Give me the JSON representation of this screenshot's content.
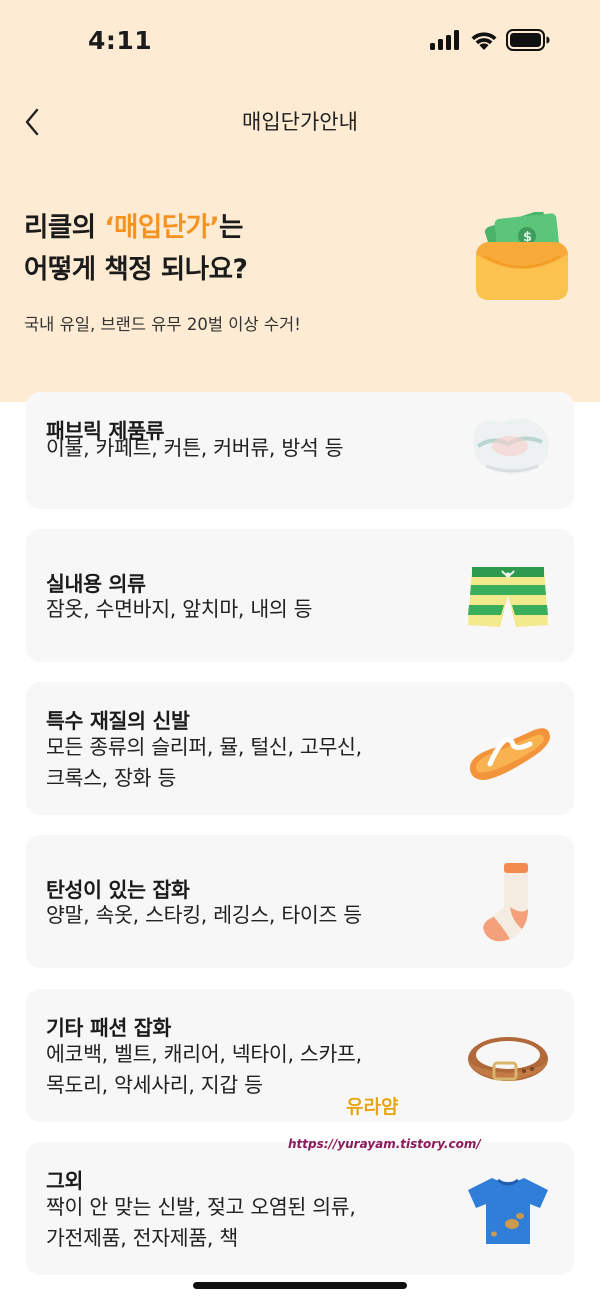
{
  "status_bar": {
    "time": "4:11"
  },
  "nav": {
    "title": "매입단가안내",
    "back_icon": "chevron-left-icon"
  },
  "hero": {
    "headline_part1": "리클의 ",
    "headline_accent": "‘매입단가’",
    "headline_part2": "는",
    "headline_line2": "어떻게 책정 되나요?",
    "subtitle": "국내 유일, 브랜드 유무 20벌 이상 수거!",
    "illustration": "money-envelope-icon",
    "accent_color": "#f6921e",
    "background_color": "#fdebd3"
  },
  "categories": [
    {
      "title": "패브릭 제품류",
      "desc_line1": "이불, 카페트, 커튼, 커버류, 방석 등",
      "desc_line2": "",
      "icon": "pillow-icon"
    },
    {
      "title": "실내용 의류",
      "desc_line1": "잠옷, 수면바지, 앞치마, 내의 등",
      "desc_line2": "",
      "icon": "shorts-icon"
    },
    {
      "title": "특수 재질의 신발",
      "desc_line1": "모든 종류의 슬리퍼, 뮬, 털신, 고무신,",
      "desc_line2": "크록스, 장화 등",
      "icon": "flip-flop-icon"
    },
    {
      "title": "탄성이 있는 잡화",
      "desc_line1": "양말, 속옷, 스타킹, 레깅스, 타이즈 등",
      "desc_line2": "",
      "icon": "sock-icon"
    },
    {
      "title": "기타 패션 잡화",
      "desc_line1": "에코백, 벨트, 캐리어, 넥타이, 스카프,",
      "desc_line2": "목도리, 악세사리, 지갑 등",
      "icon": "belt-icon"
    },
    {
      "title": "그외",
      "desc_line1": "짝이 안 맞는 신발, 젖고 오염된 의류,",
      "desc_line2": "가전제품, 전자제품, 책",
      "icon": "stained-tshirt-icon"
    }
  ],
  "watermark": {
    "name": "유라얌",
    "url": "https://yurayam.tistory.com/"
  }
}
